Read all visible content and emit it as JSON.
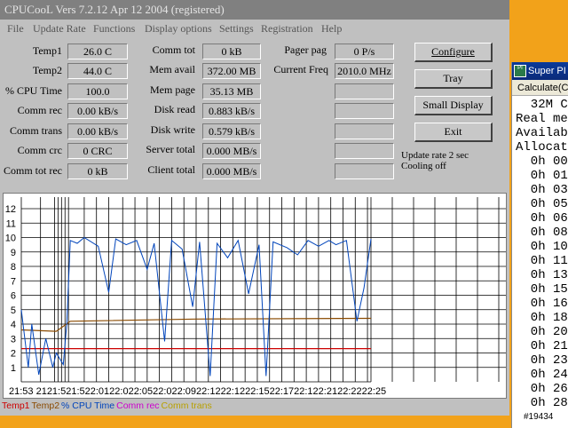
{
  "window": {
    "title": "CPUCooL  Vers 7.2.12  Apr 12 2004  (registered)",
    "menu": [
      "File",
      "Update Rate",
      "Functions",
      "Display options",
      "Settings",
      "Registration",
      "Help"
    ]
  },
  "fields_col1": [
    {
      "label": "Temp1",
      "value": "26.0 C"
    },
    {
      "label": "Temp2",
      "value": "44.0 C"
    },
    {
      "label": "% CPU Time",
      "value": "100.0"
    },
    {
      "label": "Comm rec",
      "value": "0.00 kB/s"
    },
    {
      "label": "Comm trans",
      "value": "0.00 kB/s"
    },
    {
      "label": "Comm crc",
      "value": "0 CRC"
    },
    {
      "label": "Comm tot rec",
      "value": "0 kB"
    }
  ],
  "fields_col2": [
    {
      "label": "Comm tot",
      "value": "0 kB"
    },
    {
      "label": "Mem avail",
      "value": "372.00 MB"
    },
    {
      "label": "Mem page",
      "value": "35.13 MB"
    },
    {
      "label": "Disk read",
      "value": "0.883 kB/s"
    },
    {
      "label": "Disk write",
      "value": "0.579 kB/s"
    },
    {
      "label": "Server total",
      "value": "0.000 MB/s"
    },
    {
      "label": "Client total",
      "value": "0.000 MB/s"
    }
  ],
  "fields_col3": [
    {
      "label": "Pager pag",
      "value": "0 P/s"
    },
    {
      "label": "Current Freq",
      "value": "2010.0 MHz"
    },
    {
      "label": "",
      "value": ""
    },
    {
      "label": "",
      "value": ""
    },
    {
      "label": "",
      "value": ""
    },
    {
      "label": "",
      "value": ""
    },
    {
      "label": "",
      "value": ""
    }
  ],
  "buttons": {
    "configure": "Configure",
    "tray": "Tray",
    "small_display": "Small Display",
    "exit": "Exit"
  },
  "status": {
    "update_rate": "Update rate 2 sec",
    "cooling": "Cooling off"
  },
  "legend": [
    {
      "label": "Temp1",
      "color": "#cc0000"
    },
    {
      "label": "Temp2",
      "color": "#8a4a00"
    },
    {
      "label": "% CPU Time",
      "color": "#0044bb"
    },
    {
      "label": "Comm rec",
      "color": "#cc00cc"
    },
    {
      "label": "Comm trans",
      "color": "#b8a000"
    }
  ],
  "chart_data": {
    "type": "line",
    "y_ticks": [
      "1",
      "2",
      "3",
      "4",
      "5",
      "6",
      "7",
      "8",
      "9",
      "10",
      "11",
      "12"
    ],
    "ylim": [
      0,
      12.8
    ],
    "x_tick_text": "21:53     2121:521:522:0122:022:0522:022:0922:1222:1222:1522:1722:122:2122:2222:25",
    "series": [
      {
        "name": "Temp1",
        "color": "#cc0000",
        "points": [
          [
            0,
            2.3
          ],
          [
            1,
            2.3
          ]
        ]
      },
      {
        "name": "Temp2",
        "color": "#8a4a00",
        "points": [
          [
            0,
            3.6
          ],
          [
            0.1,
            3.5
          ],
          [
            0.14,
            4.2
          ],
          [
            0.5,
            4.35
          ],
          [
            1,
            4.4
          ]
        ]
      },
      {
        "name": "% CPU Time",
        "color": "#0044bb",
        "points": [
          [
            0,
            5
          ],
          [
            0.02,
            1
          ],
          [
            0.03,
            4
          ],
          [
            0.05,
            0.5
          ],
          [
            0.07,
            3
          ],
          [
            0.09,
            1
          ],
          [
            0.1,
            2
          ],
          [
            0.12,
            1.2
          ],
          [
            0.13,
            4
          ],
          [
            0.14,
            9.8
          ],
          [
            0.16,
            9.6
          ],
          [
            0.18,
            10
          ],
          [
            0.22,
            9.4
          ],
          [
            0.25,
            6.2
          ],
          [
            0.27,
            9.9
          ],
          [
            0.3,
            9.5
          ],
          [
            0.33,
            9.8
          ],
          [
            0.36,
            7.8
          ],
          [
            0.38,
            9.6
          ],
          [
            0.41,
            2.8
          ],
          [
            0.43,
            9.8
          ],
          [
            0.46,
            9.2
          ],
          [
            0.49,
            5.2
          ],
          [
            0.51,
            9.7
          ],
          [
            0.54,
            0.4
          ],
          [
            0.56,
            9.6
          ],
          [
            0.59,
            8.6
          ],
          [
            0.62,
            9.8
          ],
          [
            0.65,
            6.1
          ],
          [
            0.68,
            9.5
          ],
          [
            0.7,
            0.4
          ],
          [
            0.72,
            9.7
          ],
          [
            0.76,
            9.3
          ],
          [
            0.79,
            8.8
          ],
          [
            0.82,
            9.8
          ],
          [
            0.85,
            9.4
          ],
          [
            0.88,
            9.8
          ],
          [
            0.9,
            9.5
          ],
          [
            0.93,
            9.8
          ],
          [
            0.96,
            4.2
          ],
          [
            0.98,
            6.5
          ],
          [
            1,
            9.9
          ]
        ]
      }
    ],
    "y_max_label": "12"
  },
  "superpi": {
    "title": "Super PI",
    "menu": "Calculate(C",
    "lines": [
      "  32M C",
      "Real me",
      "Availab",
      "Allocat",
      "  0h 00",
      "  0h 01",
      "  0h 03",
      "  0h 05",
      "  0h 06",
      "  0h 08",
      "  0h 10",
      "  0h 11",
      "  0h 13",
      "  0h 15",
      "  0h 16",
      "  0h 18",
      "  0h 20",
      "  0h 21",
      "  0h 23",
      "  0h 24",
      "  0h 26",
      "  0h 28"
    ],
    "bottom": "#19434"
  }
}
